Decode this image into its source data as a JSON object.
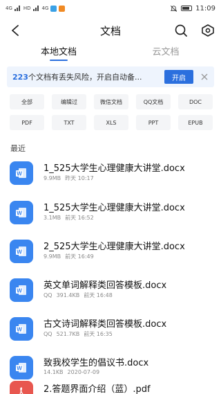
{
  "status_bar": {
    "signal_1": "4G",
    "signal_2": "HD",
    "speed": "4G",
    "time": "11:09",
    "app_badge_colors": [
      "#3aa1e6",
      "#f08a24"
    ]
  },
  "header": {
    "title": "文档",
    "back_icon": "chevron-left-icon",
    "search_icon": "search-icon",
    "eye_icon": "eye-icon"
  },
  "tabs": [
    {
      "label": "本地文档",
      "active": true
    },
    {
      "label": "云文档",
      "active": false
    }
  ],
  "banner": {
    "count": "223",
    "text": "个文档有丢失风险，开启自动备...",
    "button_label": "开启"
  },
  "filters": [
    "全部",
    "编辑过",
    "微信文档",
    "QQ文档",
    "DOC",
    "PDF",
    "TXT",
    "XLS",
    "PPT",
    "EPUB"
  ],
  "recent": {
    "label": "最近",
    "files": [
      {
        "name": "1_525大学生心理健康大讲堂.docx",
        "meta": [
          "9.9MB",
          "昨天 10:17"
        ],
        "type": "word"
      },
      {
        "name": "1_525大学生心理健康大讲堂.docx",
        "meta": [
          "3.1MB",
          "前天 16:52"
        ],
        "type": "word"
      },
      {
        "name": "2_525大学生心理健康大讲堂.docx",
        "meta": [
          "9.9MB",
          "前天 16:49"
        ],
        "type": "word"
      },
      {
        "name": "英文单词解释类回答模板.docx",
        "meta": [
          "QQ",
          "391.4KB",
          "前天 16:48"
        ],
        "type": "word"
      },
      {
        "name": "古文诗词解释类回答模板.docx",
        "meta": [
          "QQ",
          "521.7KB",
          "前天 16:35"
        ],
        "type": "word"
      },
      {
        "name": "致我校学生的倡议书.docx",
        "meta": [
          "14.1KB",
          "2020-07-09"
        ],
        "type": "word"
      },
      {
        "name": "2.答题界面介绍（蓝）.pdf",
        "meta": [],
        "type": "pdf"
      }
    ]
  },
  "colors": {
    "accent": "#2b6fde",
    "word_icon": "#3a86f0",
    "pdf_icon": "#e8574f"
  }
}
